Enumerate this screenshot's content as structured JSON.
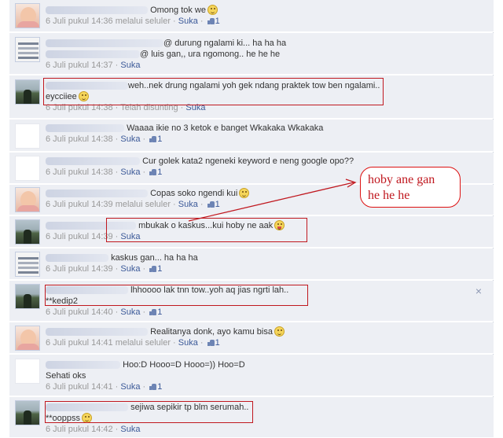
{
  "comments": [
    {
      "avatar": "baby",
      "text": "Omong tok we",
      "emoji": "smile",
      "text2": "",
      "time": "6 Juli pukul 14:36",
      "via": "melalui seluler",
      "action": "Suka",
      "likes": "1",
      "edited": ""
    },
    {
      "avatar": "doc",
      "text": "@ durung ngalami ki... ha ha ha",
      "emoji": "",
      "text2": "@ luis gan,, ura ngomong.. he he he",
      "time": "6 Juli pukul 14:37",
      "via": "",
      "action": "Suka",
      "likes": "",
      "edited": ""
    },
    {
      "avatar": "beach",
      "text": "weh..nek drung ngalami yoh gek ndang praktek tow ben ngalami..",
      "emoji": "",
      "text2": "eycciiee",
      "emoji2": "smile",
      "time": "6 Juli pukul 14:38",
      "via": "",
      "action": "Suka",
      "likes": "",
      "edited": "Telah disunting"
    },
    {
      "avatar": "white",
      "text": "Waaaa ikie no 3 ketok e banget Wkakaka Wkakaka",
      "emoji": "",
      "text2": "",
      "time": "6 Juli pukul 14:38",
      "via": "",
      "action": "Suka",
      "likes": "1",
      "edited": ""
    },
    {
      "avatar": "white",
      "text": "Cur golek kata2 ngeneki keyword e neng google opo??",
      "emoji": "",
      "text2": "",
      "time": "6 Juli pukul 14:38",
      "via": "",
      "action": "Suka",
      "likes": "1",
      "edited": ""
    },
    {
      "avatar": "baby",
      "text": "Copas soko ngendi kui",
      "emoji": "smile",
      "text2": "",
      "time": "6 Juli pukul 14:39",
      "via": "melalui seluler",
      "action": "Suka",
      "likes": "1",
      "edited": ""
    },
    {
      "avatar": "beach",
      "text": "mbukak o kaskus...kui hoby ne aak",
      "emoji": "tongue",
      "text2": "",
      "time": "6 Juli pukul 14:39",
      "via": "",
      "action": "Suka",
      "likes": "",
      "edited": ""
    },
    {
      "avatar": "doc",
      "text": "kaskus gan... ha ha ha",
      "emoji": "",
      "text2": "",
      "time": "6 Juli pukul 14:39",
      "via": "",
      "action": "Suka",
      "likes": "1",
      "edited": ""
    },
    {
      "avatar": "beach",
      "text": "lhhoooo lak tnn tow..yoh aq jias ngrti lah..",
      "emoji": "",
      "text2": "**kedip2",
      "time": "6 Juli pukul 14:40",
      "via": "",
      "action": "Suka",
      "likes": "1",
      "edited": ""
    },
    {
      "avatar": "baby",
      "text": "Realitanya donk, ayo kamu bisa",
      "emoji": "smile",
      "text2": "",
      "time": "6 Juli pukul 14:41",
      "via": "melalui seluler",
      "action": "Suka",
      "likes": "1",
      "edited": ""
    },
    {
      "avatar": "white",
      "text": "Hoo:D Hooo=D Hooo=)) Hoo=D",
      "emoji": "",
      "text2": "Sehati oks",
      "time": "6 Juli pukul 14:41",
      "via": "",
      "action": "Suka",
      "likes": "1",
      "edited": ""
    },
    {
      "avatar": "beach",
      "text": "sejiwa sepikir tp blm serumah..",
      "emoji": "",
      "text2": "**ooppss",
      "emoji2": "smile",
      "time": "6 Juli pukul 14:42",
      "via": "",
      "action": "Suka",
      "likes": "",
      "edited": ""
    }
  ],
  "annotation": {
    "line1": "hoby ane gan",
    "line2": "he he he"
  },
  "close_label": "×",
  "colors": {
    "link": "#3b5998",
    "highlight": "#c0181f",
    "row_bg": "#edeff4"
  }
}
